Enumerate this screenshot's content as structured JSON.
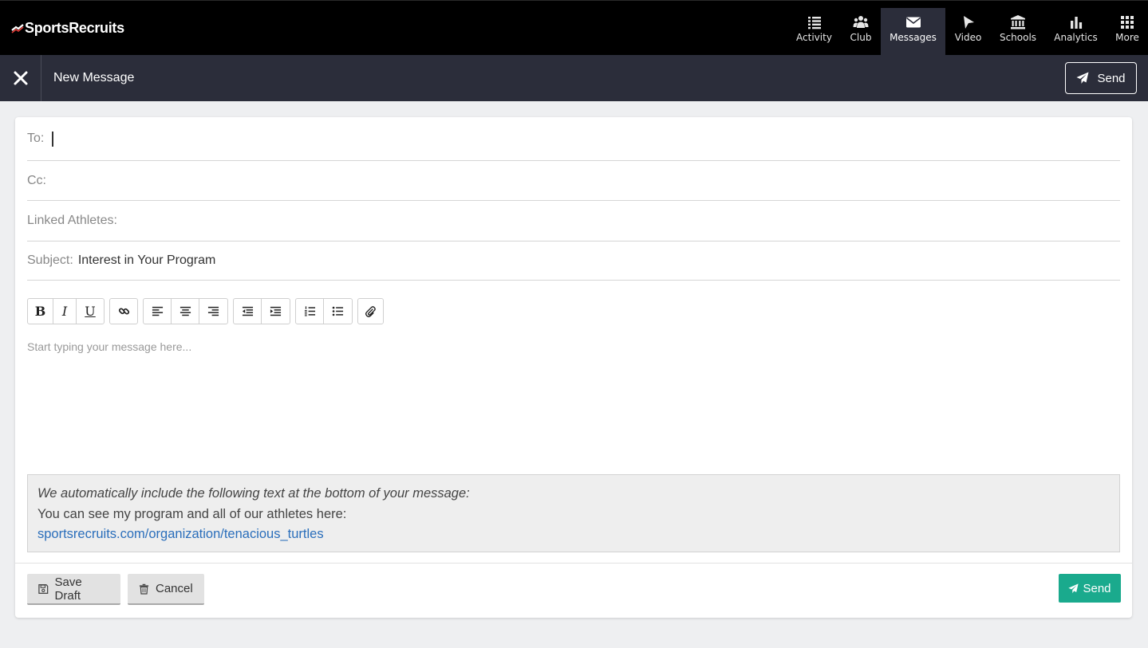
{
  "app": {
    "logo_text": "SportsRecruits",
    "colors": {
      "nav_bg": "#000000",
      "subbar_bg": "#2b2d3a",
      "accent": "#1aaa8d",
      "link": "#2a6ebb"
    }
  },
  "nav": {
    "items": [
      {
        "label": "Activity",
        "icon": "list-icon",
        "active": false
      },
      {
        "label": "Club",
        "icon": "users-icon",
        "active": false
      },
      {
        "label": "Messages",
        "icon": "envelope-icon",
        "active": true
      },
      {
        "label": "Video",
        "icon": "play-icon",
        "active": false
      },
      {
        "label": "Schools",
        "icon": "institution-icon",
        "active": false
      },
      {
        "label": "Analytics",
        "icon": "bar-chart-icon",
        "active": false
      },
      {
        "label": "More",
        "icon": "grid-icon",
        "active": false
      }
    ]
  },
  "subbar": {
    "title": "New Message",
    "send_label": "Send"
  },
  "compose": {
    "to_label": "To:",
    "to_value": "",
    "cc_label": "Cc:",
    "cc_value": "",
    "linked_label": "Linked Athletes:",
    "linked_value": "",
    "subject_label": "Subject:",
    "subject_value": "Interest in Your Program",
    "body_placeholder": "Start typing your message here...",
    "toolbar": [
      [
        "bold-icon",
        "italic-icon",
        "underline-icon"
      ],
      [
        "link-icon"
      ],
      [
        "align-left-icon",
        "align-center-icon",
        "align-right-icon"
      ],
      [
        "outdent-icon",
        "indent-icon"
      ],
      [
        "ordered-list-icon",
        "unordered-list-icon"
      ],
      [
        "attach-icon"
      ]
    ]
  },
  "signature": {
    "intro": "We automatically include the following text at the bottom of your message:",
    "line": "You can see my program and all of our athletes here:",
    "link": "sportsrecruits.com/organization/tenacious_turtles"
  },
  "footer": {
    "save_draft_label": "Save Draft",
    "cancel_label": "Cancel",
    "send_label": "Send"
  }
}
